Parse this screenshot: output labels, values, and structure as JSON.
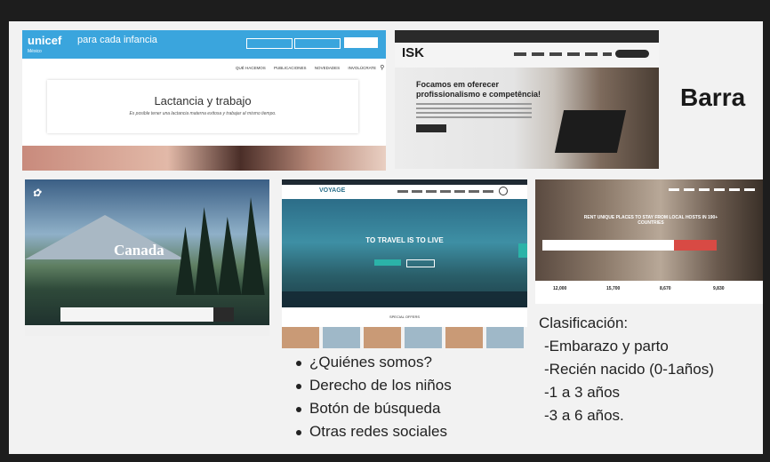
{
  "heading": "Barra",
  "features": [
    "¿Quiénes somos?",
    "Derecho de los niños",
    "Botón de búsqueda",
    "Otras redes sociales"
  ],
  "classification": {
    "title": "Clasificación:",
    "items": [
      "-Embarazo y parto",
      "-Recién nacido (0-1años)",
      "-1 a 3 años",
      "-3 a 6 años."
    ]
  },
  "unicef": {
    "logo": "unicef",
    "tagline": "para cada infancia",
    "sub": "México",
    "nav": [
      "QUÉ HACEMOS",
      "PUBLICACIONES",
      "NOVEDADES",
      "INVOLÚCRATE"
    ],
    "title": "Lactancia y trabajo",
    "subtitle": "Es posible tener una lactancia materna exitosa y trabajar al mismo tiempo."
  },
  "isk": {
    "logo": "ISK",
    "headline1": "Focamos em oferecer",
    "headline2": "profissionalismo e competência!"
  },
  "canada": {
    "title": "Canada"
  },
  "voyage": {
    "logo": "VOYAGE",
    "headline": "TO TRAVEL IS TO LIVE",
    "section": "SPECIAL OFFERS"
  },
  "rent": {
    "headline": "RENT UNIQUE PLACES TO STAY FROM LOCAL HOSTS IN 190+ COUNTRIES",
    "stats": [
      "12,000",
      "15,700",
      "8,670",
      "9,830"
    ]
  },
  "colors": {
    "unicef_blue": "#3aa5dd",
    "isk_dark": "#2a2a2a",
    "voyage_teal": "#2a6f8a",
    "rent_red": "#d84a44"
  }
}
